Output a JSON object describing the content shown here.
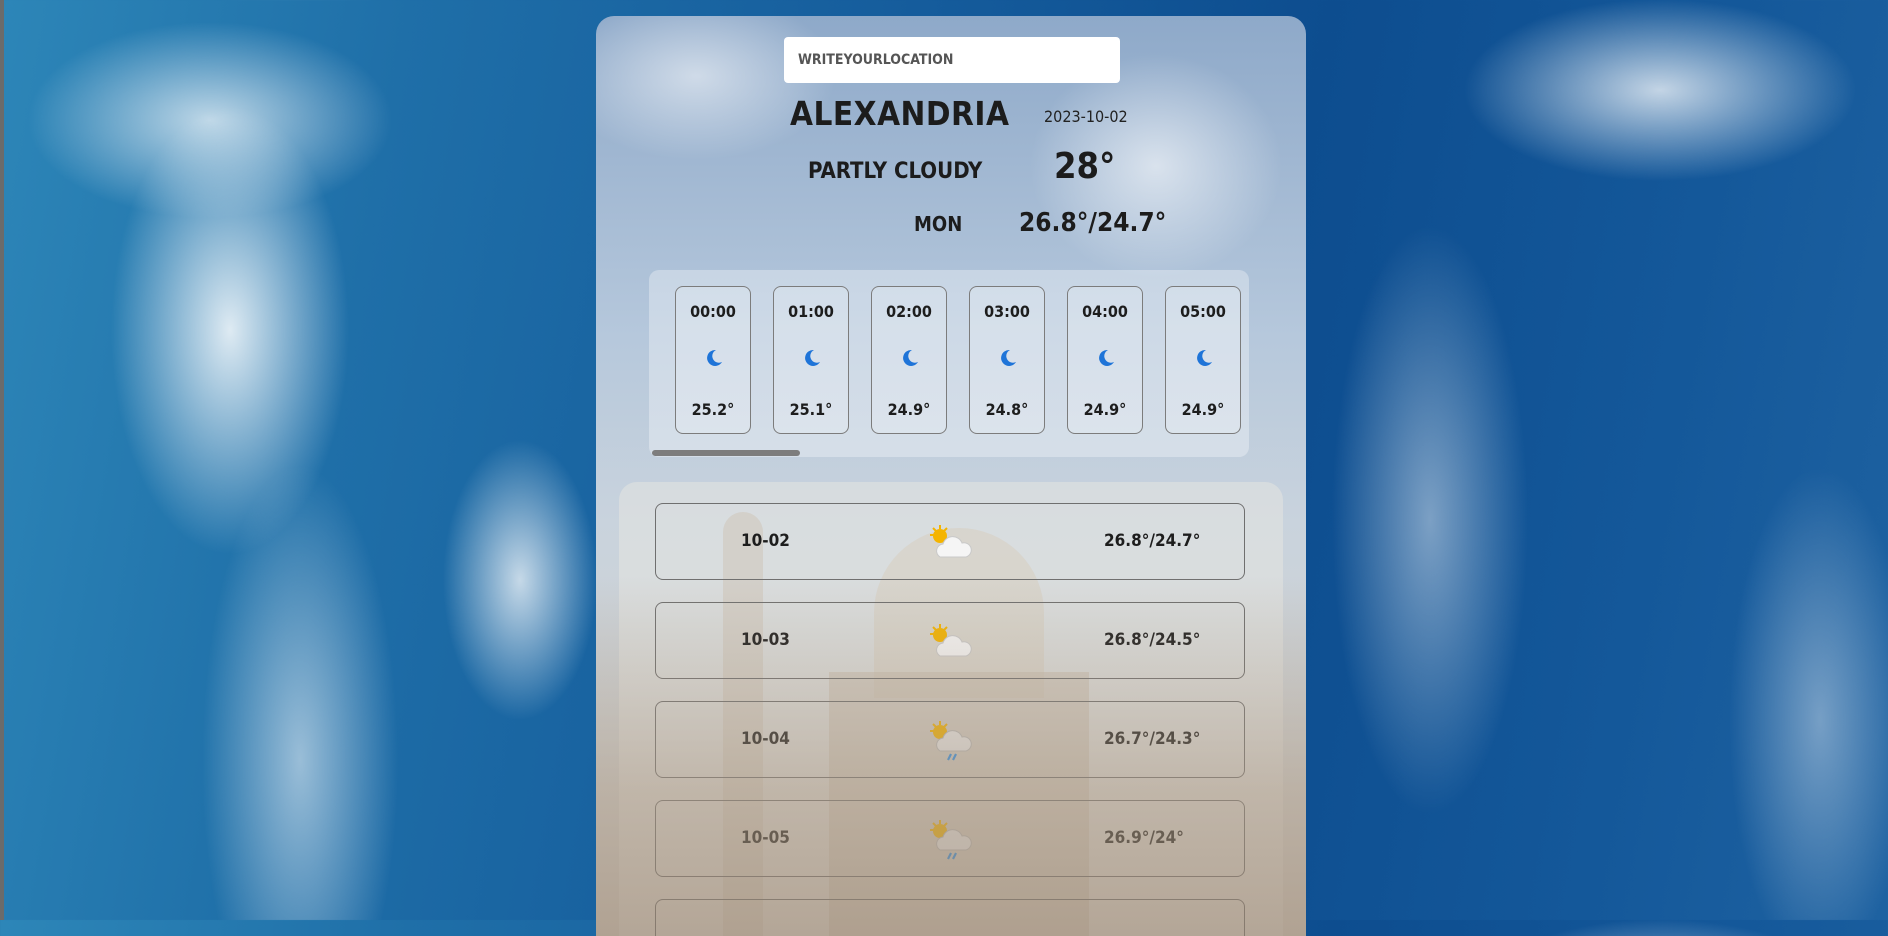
{
  "search": {
    "placeholder": "WRITEYOURLOCATION"
  },
  "current": {
    "city": "ALEXANDRIA",
    "date": "2023-10-02",
    "condition": "PARTLY CLOUDY",
    "temp": "28°",
    "day": "MON",
    "range": "26.8°/24.7°"
  },
  "hourly": [
    {
      "time": "00:00",
      "icon": "moon-icon",
      "temp": "25.2°"
    },
    {
      "time": "01:00",
      "icon": "moon-icon",
      "temp": "25.1°"
    },
    {
      "time": "02:00",
      "icon": "moon-icon",
      "temp": "24.9°"
    },
    {
      "time": "03:00",
      "icon": "moon-icon",
      "temp": "24.8°"
    },
    {
      "time": "04:00",
      "icon": "moon-icon",
      "temp": "24.9°"
    },
    {
      "time": "05:00",
      "icon": "moon-icon",
      "temp": "24.9°"
    }
  ],
  "daily": [
    {
      "date": "10-02",
      "icon": "partly-cloudy-icon",
      "range": "26.8°/24.7°"
    },
    {
      "date": "10-03",
      "icon": "partly-cloudy-icon",
      "range": "26.8°/24.5°"
    },
    {
      "date": "10-04",
      "icon": "sun-rain-cloud-icon",
      "range": "26.7°/24.3°"
    },
    {
      "date": "10-05",
      "icon": "sun-rain-cloud-icon",
      "range": "26.9°/24°"
    }
  ],
  "colors": {
    "moon": "#1e74d8",
    "sun": "#f4b400",
    "rain": "#2a8ee8"
  }
}
